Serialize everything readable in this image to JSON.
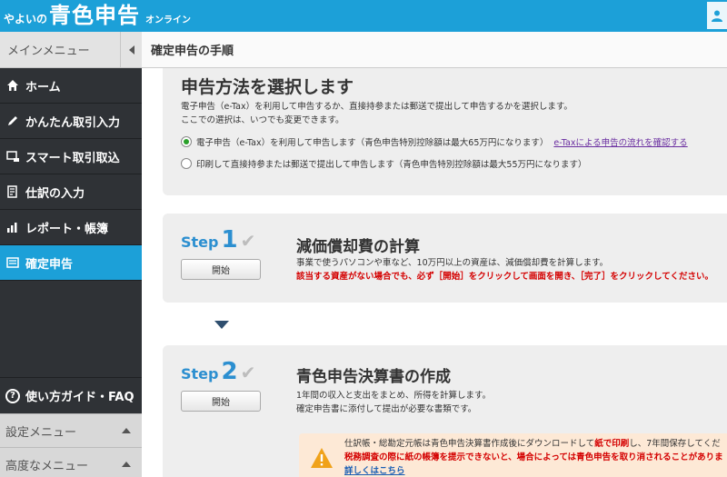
{
  "header": {
    "logo_small": "やよいの",
    "logo_big": "青色申告",
    "logo_online": "オンライン"
  },
  "sidebar": {
    "menu_title": "メインメニュー",
    "items": [
      {
        "label": "ホーム",
        "icon": "home-icon"
      },
      {
        "label": "かんたん取引入力",
        "icon": "pencil-icon"
      },
      {
        "label": "スマート取引取込",
        "icon": "import-icon"
      },
      {
        "label": "仕訳の入力",
        "icon": "journal-icon"
      },
      {
        "label": "レポート・帳簿",
        "icon": "report-icon"
      },
      {
        "label": "確定申告",
        "icon": "tax-return-icon",
        "active": true
      }
    ],
    "guide_label": "使い方ガイド・FAQ",
    "settings_menu": "設定メニュー",
    "advanced_menu": "高度なメニュー"
  },
  "main": {
    "page_title": "確定申告の手順",
    "method": {
      "title": "申告方法を選択します",
      "desc1": "電子申告（e-Tax）を利用して申告するか、直接持参または郵送で提出して申告するかを選択します。",
      "desc2": "ここでの選択は、いつでも変更できます。",
      "option_etax": "電子申告（e-Tax）を利用して申告します（青色申告特別控除額は最大65万円になります）",
      "option_etax_link": "e-Taxによる申告の流れを確認する",
      "option_print": "印刷して直接持参または郵送で提出して申告します（青色申告特別控除額は最大55万円になります）"
    },
    "step1": {
      "word": "Step",
      "num": "1",
      "button": "開始",
      "title": "減価償却費の計算",
      "desc": "事業で使うパソコンや車など、10万円以上の資産は、減価償却費を計算します。",
      "warning": "該当する資産がない場合でも、必ず［開始］をクリックして画面を開き、［完了］をクリックしてください。"
    },
    "step2": {
      "word": "Step",
      "num": "2",
      "button": "開始",
      "title": "青色申告決算書の作成",
      "desc1": "1年間の収入と支出をまとめ、所得を計算します。",
      "desc2": "確定申告書に添付して提出が必要な書類です。",
      "notice_prefix": "仕訳帳・総勘定元帳は青色申告決算書作成後にダウンロードして",
      "notice_red": "紙で印刷",
      "notice_suffix": "し、7年間保存してくだ",
      "notice2": "税務調査の際に紙の帳簿を提示できないと、場合によっては青色申告を取り消されることがありま",
      "notice_link": "詳しくはこちら"
    }
  },
  "colors": {
    "brand": "#1ca0d8",
    "sidebar_bg": "#2f3236",
    "step_blue": "#2c8fd0",
    "warning_red": "#d40000"
  }
}
